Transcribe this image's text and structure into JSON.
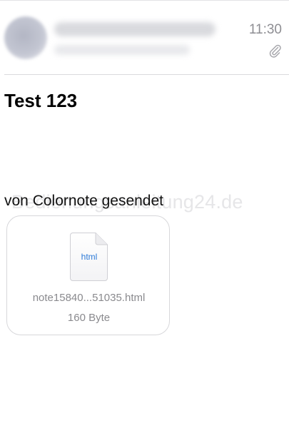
{
  "message_header": {
    "time": "11:30",
    "has_attachment_icon": "paperclip-icon"
  },
  "message": {
    "subject": "Test 123",
    "body_text": "von Colornote gesendet",
    "watermark": "Bedienungsanleitung24.de"
  },
  "attachment": {
    "icon": "html-file-icon",
    "icon_label": "html",
    "file_name": "note15840...51035.html",
    "file_size": "160 Byte"
  },
  "colors": {
    "link_blue": "#2e7bd8",
    "secondary_text": "#8a8a8e"
  }
}
